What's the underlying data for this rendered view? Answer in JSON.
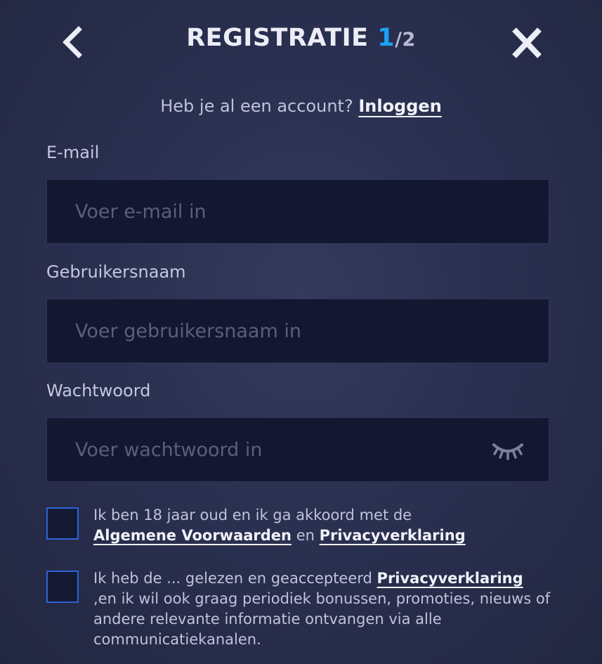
{
  "header": {
    "title": "REGISTRATIE",
    "step_current": "1",
    "step_separator": "/",
    "step_total": "2",
    "back_icon": "chevron-left-icon",
    "close_icon": "close-icon"
  },
  "login_prompt": {
    "text": "Heb je al een account?",
    "link": "Inloggen"
  },
  "fields": {
    "email": {
      "label": "E-mail",
      "placeholder": "Voer e-mail in",
      "value": ""
    },
    "username": {
      "label": "Gebruikersnaam",
      "placeholder": "Voer gebruikersnaam in",
      "value": ""
    },
    "password": {
      "label": "Wachtwoord",
      "placeholder": "Voer wachtwoord in",
      "value": "",
      "toggle_icon": "eye-closed-icon"
    }
  },
  "consents": {
    "terms": {
      "checked": false,
      "text_before": "Ik ben 18 jaar oud en ik ga akkoord met de",
      "link_terms": "Algemene Voorwaarden",
      "conjunction": "en",
      "link_privacy": "Privacyverklaring"
    },
    "marketing": {
      "checked": false,
      "text_before": "Ik heb de ... gelezen en geaccepteerd",
      "link_privacy": "Privacyverklaring",
      "text_after": ",en ik wil ook graag periodiek bonussen, promoties, nieuws of andere relevante informatie ontvangen via alle communicatiekanalen."
    }
  },
  "colors": {
    "background": "#2a3050",
    "accent": "#1aa3f5",
    "checkbox_border": "#2d63d8",
    "input_background": "#131730"
  }
}
